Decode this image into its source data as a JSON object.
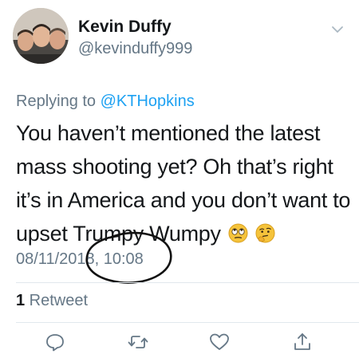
{
  "author": {
    "name": "Kevin Duffy",
    "handle": "@kevinduffy999"
  },
  "reply": {
    "prefix": "Replying to ",
    "mention": "@KTHopkins"
  },
  "tweet": {
    "text": "You haven’t mentioned the latest mass shooting yet? Oh that’s right it’s in America and you don’t want to upset Trumpy Wumpy",
    "emojis": [
      "eye-roll-face-emoji",
      "thinking-face-emoji"
    ],
    "timestamp": "08/11/2018, 10:08"
  },
  "stats": {
    "retweet_count": "1",
    "retweet_label": " Retweet"
  },
  "actions": [
    "reply-icon",
    "retweet-icon",
    "like-icon",
    "share-icon"
  ],
  "colors": {
    "text": "#14171a",
    "secondary": "#657786",
    "link": "#1da1f2",
    "divider": "#e1e8ed",
    "emoji_yellow": "#f5c33b"
  }
}
